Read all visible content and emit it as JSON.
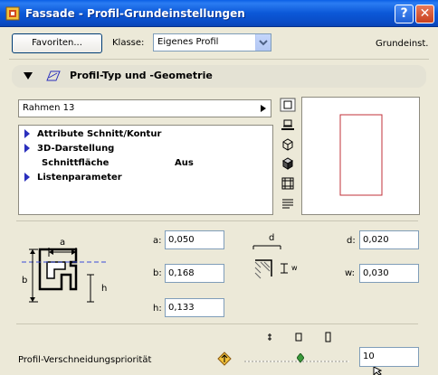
{
  "window": {
    "title": "Fassade - Profil-Grundeinstellungen",
    "help": "?",
    "close": "✕"
  },
  "toolbar": {
    "favorites_label": "Favoriten...",
    "class_label": "Klasse:",
    "class_value": "Eigenes Profil",
    "defaults_label": "Grundeinst."
  },
  "section": {
    "title": "Profil-Typ und -Geometrie"
  },
  "profile_select": {
    "value": "Rahmen 13"
  },
  "tree": {
    "items": [
      {
        "label": "Attribute Schnitt/Kontur",
        "expandable": true
      },
      {
        "label": "3D-Darstellung",
        "expandable": true
      },
      {
        "label": "Schnittfläche",
        "value": "Aus",
        "expandable": false
      },
      {
        "label": "Listenparameter",
        "expandable": true
      }
    ]
  },
  "side_icons": [
    "square-outline-icon",
    "printer-icon",
    "cube-wireframe-icon",
    "cube-solid-icon",
    "film-strip-icon",
    "list-lines-icon"
  ],
  "params": {
    "a": {
      "label": "a:",
      "value": "0,050"
    },
    "b": {
      "label": "b:",
      "value": "0,168"
    },
    "h": {
      "label": "h:",
      "value": "0,133"
    },
    "d": {
      "label": "d:",
      "value": "0,020"
    },
    "w": {
      "label": "w:",
      "value": "0,030"
    }
  },
  "diagram": {
    "a": "a",
    "b": "b",
    "h": "h",
    "d": "d",
    "w": "w"
  },
  "priority": {
    "label": "Profil-Verschneidungspriorität",
    "value": "10"
  },
  "colors": {
    "accent": "#0a5fe6",
    "preview_rect": "#c0303a",
    "tree_arrow": "#2a2fbd"
  }
}
